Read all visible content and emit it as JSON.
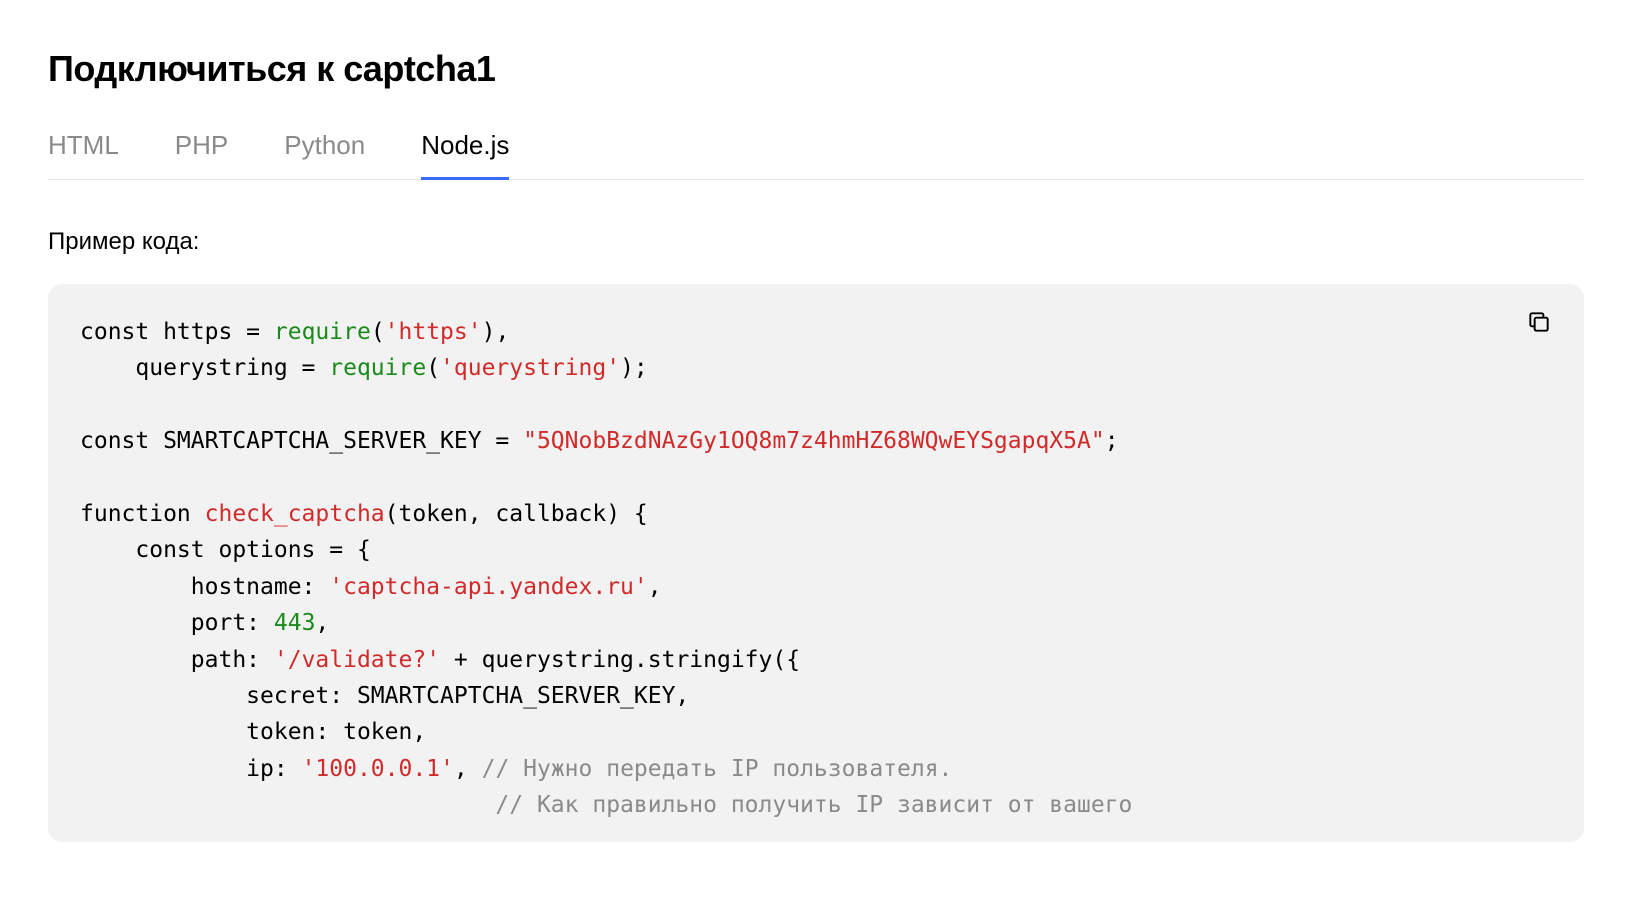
{
  "header": {
    "title": "Подключиться к captcha1"
  },
  "tabs": [
    {
      "label": "HTML",
      "active": false
    },
    {
      "label": "PHP",
      "active": false
    },
    {
      "label": "Python",
      "active": false
    },
    {
      "label": "Node.js",
      "active": true
    }
  ],
  "subtitle": "Пример кода:",
  "copy_button": {
    "name": "copy-icon"
  },
  "code": {
    "tokens": [
      [
        {
          "t": "const https = "
        },
        {
          "t": "require",
          "c": "tk-fn"
        },
        {
          "t": "("
        },
        {
          "t": "'https'",
          "c": "tk-str"
        },
        {
          "t": "),"
        }
      ],
      [
        {
          "t": "    querystring = "
        },
        {
          "t": "require",
          "c": "tk-fn"
        },
        {
          "t": "("
        },
        {
          "t": "'querystring'",
          "c": "tk-str"
        },
        {
          "t": ");"
        }
      ],
      [],
      [
        {
          "t": "const SMARTCAPTCHA_SERVER_KEY = "
        },
        {
          "t": "\"5QNobBzdNAzGy1OQ8m7z4hmHZ68WQwEYSgapqX5A\"",
          "c": "tk-str"
        },
        {
          "t": ";"
        }
      ],
      [],
      [
        {
          "t": "function "
        },
        {
          "t": "check_captcha",
          "c": "tk-name"
        },
        {
          "t": "(token, callback) {"
        }
      ],
      [
        {
          "t": "    const options = {"
        }
      ],
      [
        {
          "t": "        hostname: "
        },
        {
          "t": "'captcha-api.yandex.ru'",
          "c": "tk-str"
        },
        {
          "t": ","
        }
      ],
      [
        {
          "t": "        port: "
        },
        {
          "t": "443",
          "c": "tk-num"
        },
        {
          "t": ","
        }
      ],
      [
        {
          "t": "        path: "
        },
        {
          "t": "'/validate?'",
          "c": "tk-str"
        },
        {
          "t": " + querystring.stringify({"
        }
      ],
      [
        {
          "t": "            secret: SMARTCAPTCHA_SERVER_KEY,"
        }
      ],
      [
        {
          "t": "            token: token,"
        }
      ],
      [
        {
          "t": "            ip: "
        },
        {
          "t": "'100.0.0.1'",
          "c": "tk-str"
        },
        {
          "t": ", "
        },
        {
          "t": "// Нужно передать IP пользователя.",
          "c": "tk-cmt"
        }
      ],
      [
        {
          "t": "                              "
        },
        {
          "t": "// Как правильно получить IP зависит от вашего",
          "c": "tk-cmt"
        }
      ]
    ]
  }
}
